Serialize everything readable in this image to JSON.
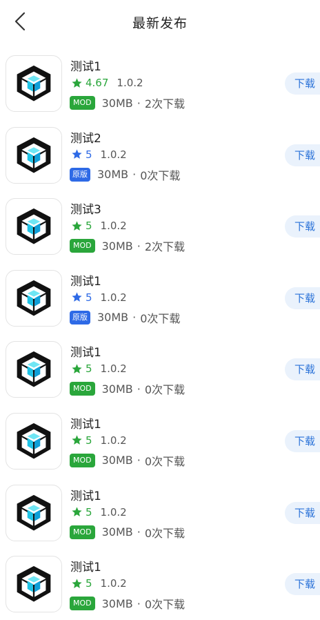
{
  "header": {
    "title": "最新发布",
    "back_icon": "chevron-left-icon"
  },
  "colors": {
    "green_star": "#2aa63b",
    "blue_star": "#2e6ae6",
    "mod_tag": "#2aa63b",
    "orig_tag": "#2e6ae6",
    "button_bg": "#eaf2fc",
    "button_text": "#2a72d8"
  },
  "apps": [
    {
      "name": "测试1",
      "rating": "4.67",
      "star_color": "green",
      "version": "1.0.2",
      "tag": "MOD",
      "tag_type": "mod",
      "size": "30MB",
      "downloads": "2次下载",
      "button": "下载"
    },
    {
      "name": "测试2",
      "rating": "5",
      "star_color": "blue",
      "version": "1.0.2",
      "tag": "原版",
      "tag_type": "orig",
      "size": "30MB",
      "downloads": "0次下载",
      "button": "下载"
    },
    {
      "name": "测试3",
      "rating": "5",
      "star_color": "green",
      "version": "1.0.2",
      "tag": "MOD",
      "tag_type": "mod",
      "size": "30MB",
      "downloads": "2次下载",
      "button": "下载"
    },
    {
      "name": "测试1",
      "rating": "5",
      "star_color": "blue",
      "version": "1.0.2",
      "tag": "原版",
      "tag_type": "orig",
      "size": "30MB",
      "downloads": "0次下载",
      "button": "下载"
    },
    {
      "name": "测试1",
      "rating": "5",
      "star_color": "green",
      "version": "1.0.2",
      "tag": "MOD",
      "tag_type": "mod",
      "size": "30MB",
      "downloads": "0次下载",
      "button": "下载"
    },
    {
      "name": "测试1",
      "rating": "5",
      "star_color": "green",
      "version": "1.0.2",
      "tag": "MOD",
      "tag_type": "mod",
      "size": "30MB",
      "downloads": "0次下载",
      "button": "下载"
    },
    {
      "name": "测试1",
      "rating": "5",
      "star_color": "green",
      "version": "1.0.2",
      "tag": "MOD",
      "tag_type": "mod",
      "size": "30MB",
      "downloads": "0次下载",
      "button": "下载"
    },
    {
      "name": "测试1",
      "rating": "5",
      "star_color": "green",
      "version": "1.0.2",
      "tag": "MOD",
      "tag_type": "mod",
      "size": "30MB",
      "downloads": "0次下载",
      "button": "下载"
    }
  ]
}
